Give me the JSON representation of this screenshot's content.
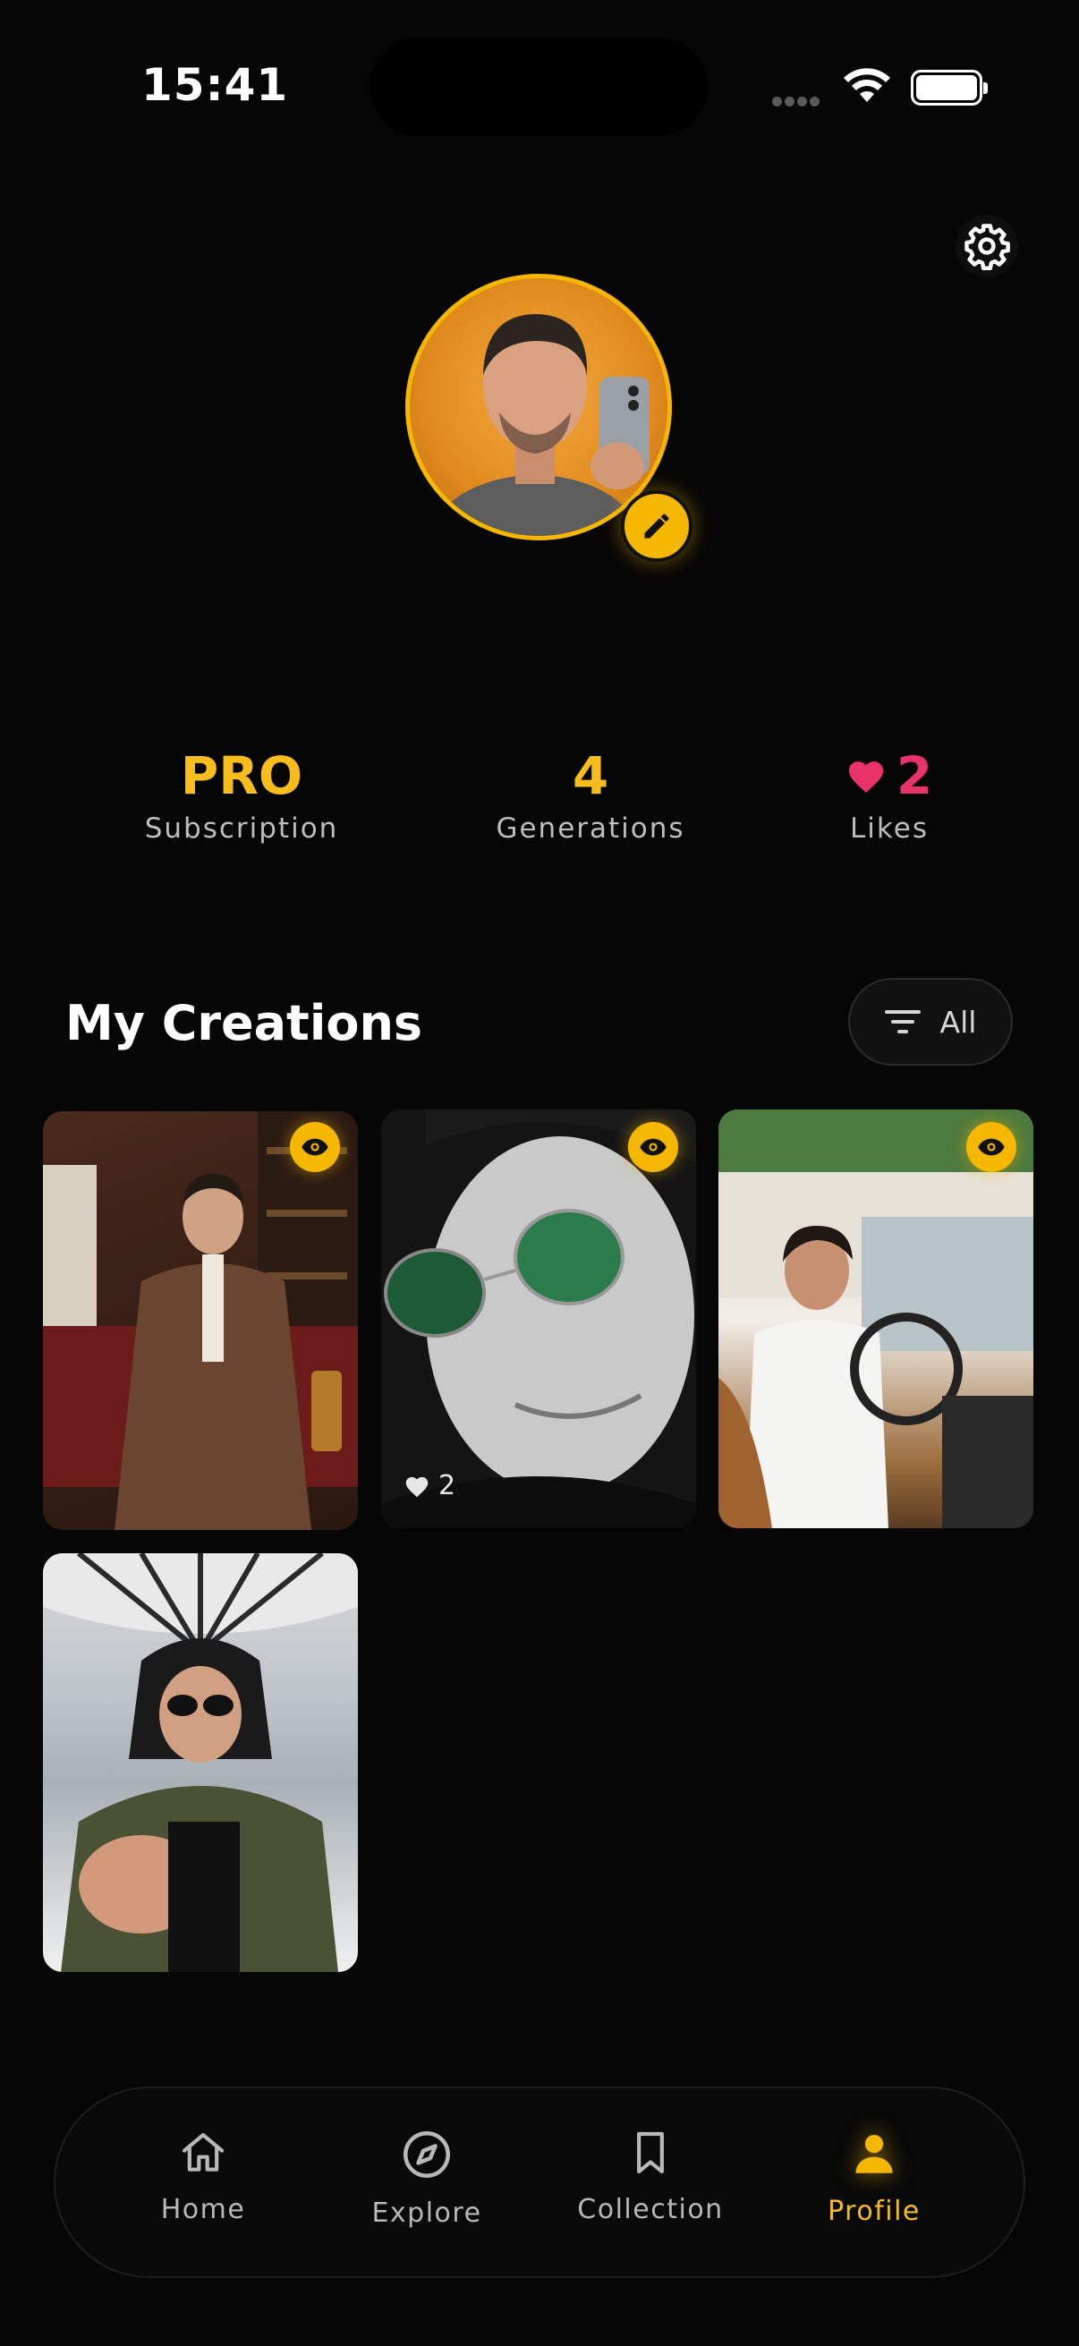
{
  "status_bar": {
    "time": "15:41"
  },
  "stats": [
    {
      "value": "PRO",
      "label": "Subscription"
    },
    {
      "value": "4",
      "label": "Generations"
    },
    {
      "value": "2",
      "label": "Likes"
    }
  ],
  "creations": {
    "title": "My Creations",
    "filter_label": "All",
    "cards": [
      {
        "image": "man-in-brown-suit-in-lounge",
        "likes": ""
      },
      {
        "image": "man-black-white-green-sunglasses",
        "likes": "2"
      },
      {
        "image": "man-driving-car",
        "likes": ""
      },
      {
        "image": "man-in-hoodie-sunglasses",
        "likes": ""
      }
    ]
  },
  "nav": {
    "items": [
      {
        "label": "Home",
        "icon": "home-icon"
      },
      {
        "label": "Explore",
        "icon": "compass-icon"
      },
      {
        "label": "Collection",
        "icon": "bookmark-icon"
      },
      {
        "label": "Profile",
        "icon": "user-icon"
      }
    ],
    "active": "Profile"
  },
  "colors": {
    "accent": "#f5b700",
    "like": "#e8336a",
    "background": "#060606"
  }
}
